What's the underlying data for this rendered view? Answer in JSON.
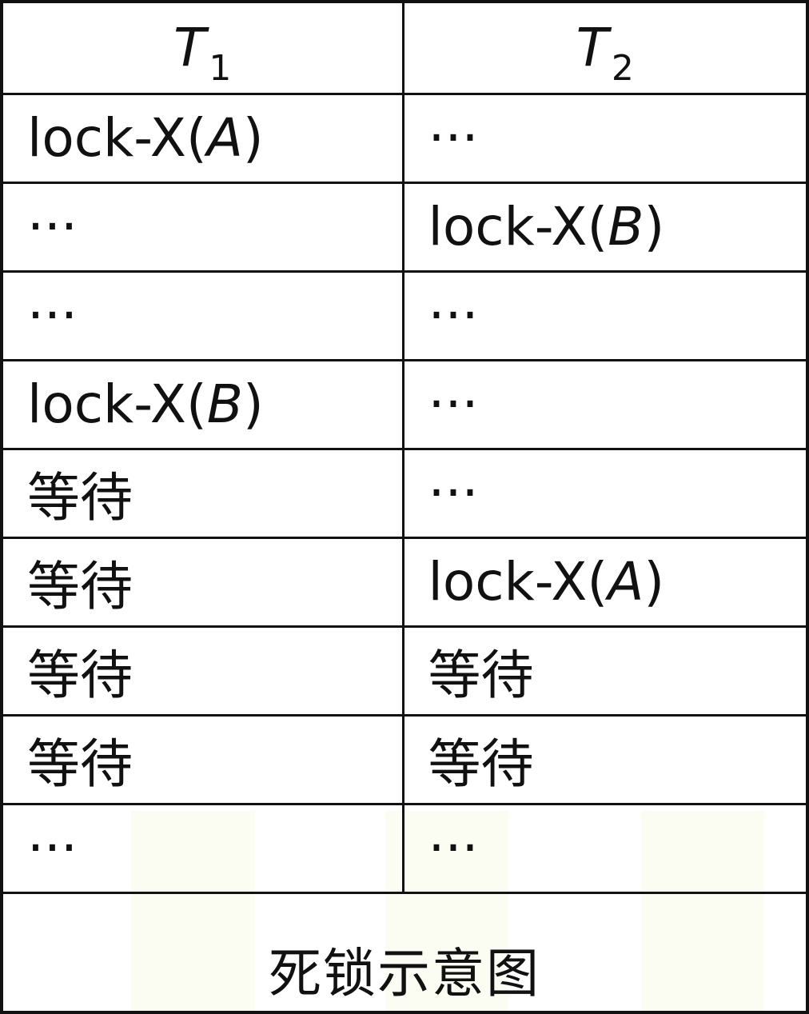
{
  "table": {
    "headers": [
      {
        "var": "T",
        "sub": "1"
      },
      {
        "var": "T",
        "sub": "2"
      }
    ],
    "rows": [
      [
        {
          "pre": "lock-X(",
          "var": "A",
          "post": ")"
        },
        {
          "text": "···"
        }
      ],
      [
        {
          "text": "···"
        },
        {
          "pre": "lock-X(",
          "var": "B",
          "post": ")"
        }
      ],
      [
        {
          "text": "···"
        },
        {
          "text": "···"
        }
      ],
      [
        {
          "pre": "lock-X(",
          "var": "B",
          "post": ")"
        },
        {
          "text": "···"
        }
      ],
      [
        {
          "text": "等待"
        },
        {
          "text": "···"
        }
      ],
      [
        {
          "text": "等待"
        },
        {
          "pre": "lock-X(",
          "var": "A",
          "post": ")"
        }
      ],
      [
        {
          "text": "等待"
        },
        {
          "text": "等待"
        }
      ],
      [
        {
          "text": "等待"
        },
        {
          "text": "等待"
        }
      ],
      [
        {
          "text": "···"
        },
        {
          "text": "···"
        }
      ]
    ]
  },
  "caption": "死锁示意图"
}
